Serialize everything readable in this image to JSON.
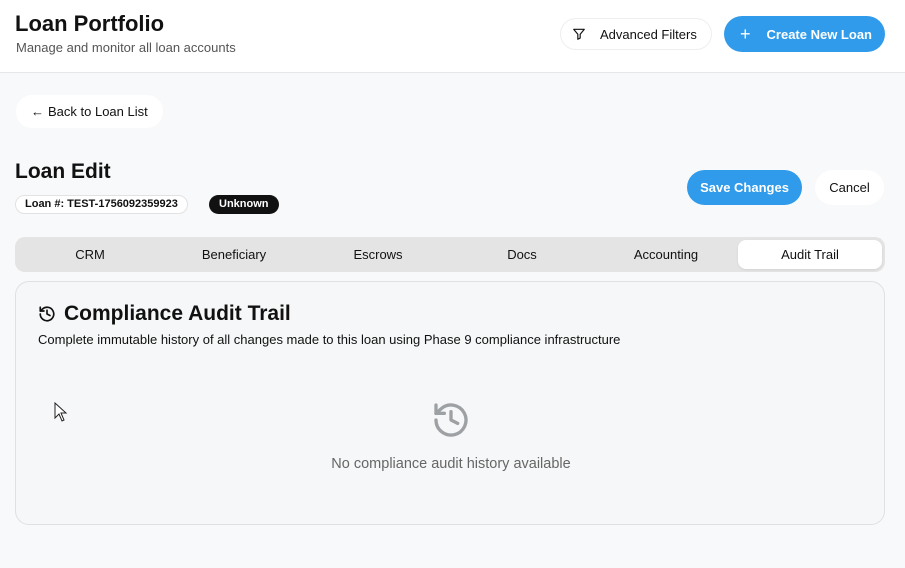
{
  "header": {
    "title": "Loan Portfolio",
    "subtitle": "Manage and monitor all loan accounts",
    "filters_label": "Advanced Filters",
    "create_label": "Create New Loan"
  },
  "nav": {
    "back_label": "Back to Loan List"
  },
  "loan": {
    "page_title": "Loan Edit",
    "number_label": "Loan #: TEST-1756092359923",
    "status": "Unknown"
  },
  "actions": {
    "save_label": "Save Changes",
    "cancel_label": "Cancel"
  },
  "tabs": [
    {
      "label": "CRM",
      "active": false
    },
    {
      "label": "Beneficiary",
      "active": false
    },
    {
      "label": "Escrows",
      "active": false
    },
    {
      "label": "Docs",
      "active": false
    },
    {
      "label": "Accounting",
      "active": false
    },
    {
      "label": "Audit Trail",
      "active": true
    }
  ],
  "audit": {
    "title": "Compliance Audit Trail",
    "description": "Complete immutable history of all changes made to this loan using Phase 9 compliance infrastructure",
    "empty_message": "No compliance audit history available"
  },
  "colors": {
    "accent": "#2f9bea",
    "badge_bg": "#111111"
  },
  "icons": {
    "filter": "filter-icon",
    "plus": "plus-icon",
    "back": "arrow-left-icon",
    "history": "history-icon"
  }
}
